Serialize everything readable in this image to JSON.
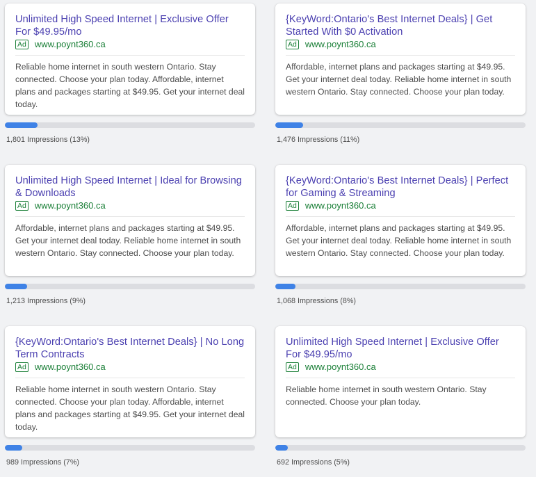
{
  "ads": [
    {
      "headline": "Unlimited High Speed Internet | Exclusive Offer For $49.95/mo",
      "badge": "Ad",
      "url": "www.poynt360.ca",
      "description": "Reliable home internet in south western Ontario. Stay connected. Choose your plan today. Affordable, internet plans and packages starting at $49.95. Get your internet deal today.",
      "impressions_label": "1,801 Impressions (13%)",
      "impressions": 1801,
      "share": 0.13
    },
    {
      "headline": "{KeyWord:Ontario's Best Internet Deals} | Get Started With $0 Activation",
      "badge": "Ad",
      "url": "www.poynt360.ca",
      "description": "Affordable, internet plans and packages starting at $49.95. Get your internet deal today. Reliable home internet in south western Ontario. Stay connected. Choose your plan today.",
      "impressions_label": "1,476 Impressions (11%)",
      "impressions": 1476,
      "share": 0.11
    },
    {
      "headline": "Unlimited High Speed Internet | Ideal for Browsing & Downloads",
      "badge": "Ad",
      "url": "www.poynt360.ca",
      "description": "Affordable, internet plans and packages starting at $49.95. Get your internet deal today. Reliable home internet in south western Ontario. Stay connected. Choose your plan today.",
      "impressions_label": "1,213 Impressions (9%)",
      "impressions": 1213,
      "share": 0.09
    },
    {
      "headline": "{KeyWord:Ontario's Best Internet Deals} | Perfect for Gaming & Streaming",
      "badge": "Ad",
      "url": "www.poynt360.ca",
      "description": "Affordable, internet plans and packages starting at $49.95. Get your internet deal today. Reliable home internet in south western Ontario. Stay connected. Choose your plan today.",
      "impressions_label": "1,068 Impressions (8%)",
      "impressions": 1068,
      "share": 0.08
    },
    {
      "headline": "{KeyWord:Ontario's Best Internet Deals} | No Long Term Contracts",
      "badge": "Ad",
      "url": "www.poynt360.ca",
      "description": "Reliable home internet in south western Ontario. Stay connected. Choose your plan today. Affordable, internet plans and packages starting at $49.95. Get your internet deal today.",
      "impressions_label": "989 Impressions (7%)",
      "impressions": 989,
      "share": 0.07
    },
    {
      "headline": "Unlimited High Speed Internet | Exclusive Offer For $49.95/mo",
      "badge": "Ad",
      "url": "www.poynt360.ca",
      "description": "Reliable home internet in south western Ontario. Stay connected. Choose your plan today.",
      "impressions_label": "692 Impressions (5%)",
      "impressions": 692,
      "share": 0.05
    }
  ],
  "colors": {
    "headline": "#4a3fb0",
    "url": "#1a7f37",
    "bar_fill": "#3f82e6",
    "bar_track": "#dcdde1",
    "background": "#f1f2f4"
  }
}
